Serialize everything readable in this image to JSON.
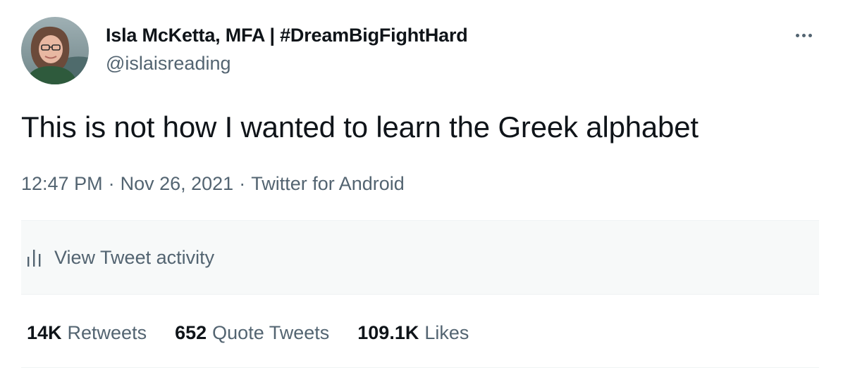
{
  "author": {
    "display_name": "Isla McKetta, MFA | #DreamBigFightHard",
    "handle": "@islaisreading"
  },
  "tweet": {
    "text": "This is not how I wanted to learn the Greek alphabet"
  },
  "meta": {
    "time": "12:47 PM",
    "date": "Nov 26, 2021",
    "source": "Twitter for Android",
    "separator": "·"
  },
  "activity": {
    "label": "View Tweet activity",
    "icon": "bar-chart-icon"
  },
  "stats": [
    {
      "count": "14K",
      "label": "Retweets"
    },
    {
      "count": "652",
      "label": "Quote Tweets"
    },
    {
      "count": "109.1K",
      "label": "Likes"
    }
  ],
  "icons": {
    "more": "more-options-icon"
  },
  "colors": {
    "text_primary": "#0f1419",
    "text_secondary": "#536471",
    "activity_bg": "#f7f9f9",
    "divider": "#eff3f4"
  }
}
